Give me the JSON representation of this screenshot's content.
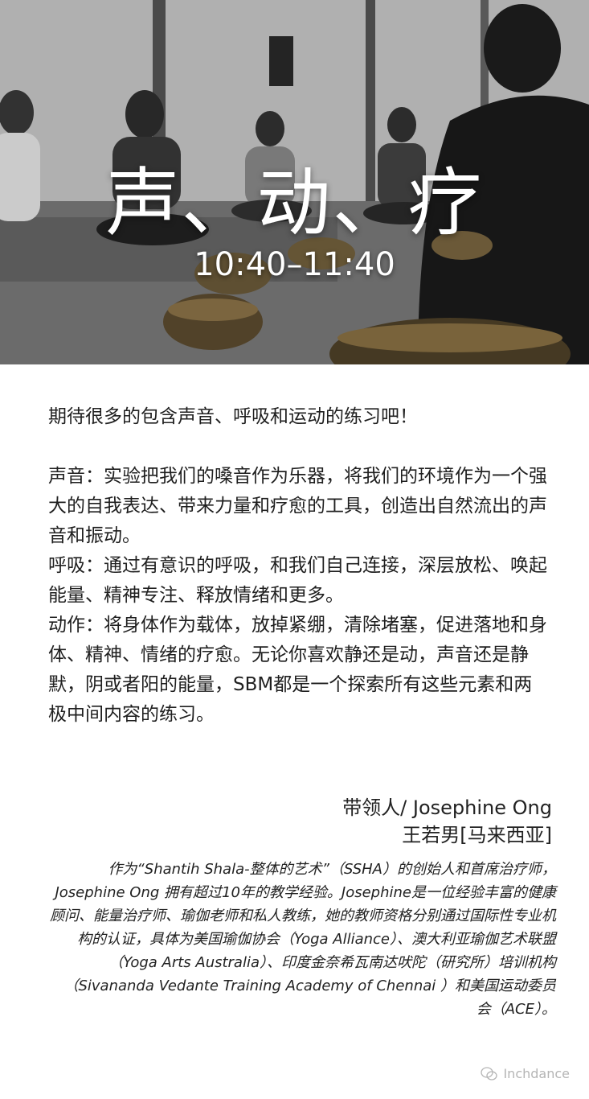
{
  "hero": {
    "title": "声、动、疗",
    "time": "10:40–11:40"
  },
  "intro": "期待很多的包含声音、呼吸和运动的练习吧！",
  "paragraphs": [
    "声音：实验把我们的嗓音作为乐器，将我们的环境作为一个强大的自我表达、带来力量和疗愈的工具，创造出自然流出的声音和振动。",
    "呼吸：通过有意识的呼吸，和我们自己连接，深层放松、唤起能量、精神专注、释放情绪和更多。",
    "动作：将身体作为载体，放掉紧绷，清除堵塞，促进落地和身体、精神、情绪的疗愈。无论你喜欢静还是动，声音还是静默，阴或者阳的能量，SBM都是一个探索所有这些元素和两极中间内容的练习。"
  ],
  "leader": {
    "line1": "带领人/ Josephine Ong",
    "line2": "王若男[马来西亚]"
  },
  "bio": "作为“Shantih Shala-整体的艺术”（SSHA）的创始人和首席治疗师，Josephine Ong 拥有超过10年的教学经验。Josephine是一位经验丰富的健康顾问、能量治疗师、瑜伽老师和私人教练，她的教师资格分别通过国际性专业机构的认证，具体为美国瑜伽协会（Yoga Alliance）、澳大利亚瑜伽艺术联盟（Yoga Arts Australia）、印度金奈希瓦南达吠陀（研究所）培训机构（Sivananda Vedante Training Academy of Chennai ）和美国运动委员会（ACE）。",
  "watermark": "Inchdance",
  "icons": {
    "watermark": "wechat-icon"
  }
}
